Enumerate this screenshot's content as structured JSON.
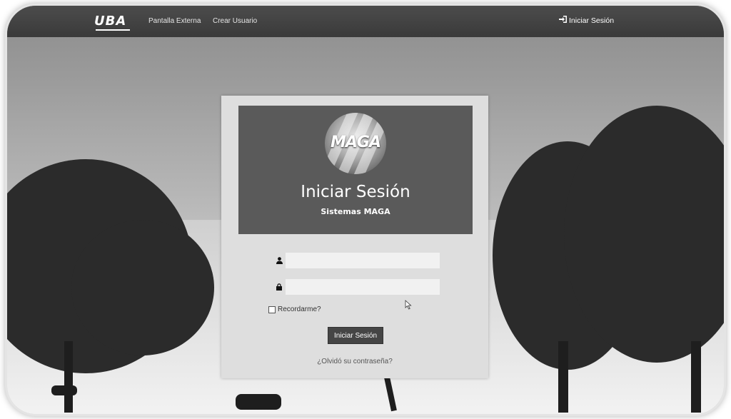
{
  "navbar": {
    "brand": "UBA",
    "links": [
      "Pantalla Externa",
      "Crear Usuario"
    ],
    "login_label": "Iniciar Sesión",
    "login_icon": "sign-in-icon"
  },
  "login_card": {
    "logo_text": "MAGA",
    "title": "Iniciar Sesión",
    "subtitle": "Sistemas MAGA",
    "username": {
      "value": "",
      "placeholder": "",
      "icon": "user-icon"
    },
    "password": {
      "value": "",
      "placeholder": "",
      "icon": "lock-icon"
    },
    "remember_label": "Recordarme?",
    "remember_checked": false,
    "submit_label": "Iniciar Sesión",
    "forgot_label": "¿Olvidó su contraseña?"
  },
  "colors": {
    "navbar": "#3f3f3f",
    "card_header": "#5a5a5a",
    "button": "#454545"
  }
}
